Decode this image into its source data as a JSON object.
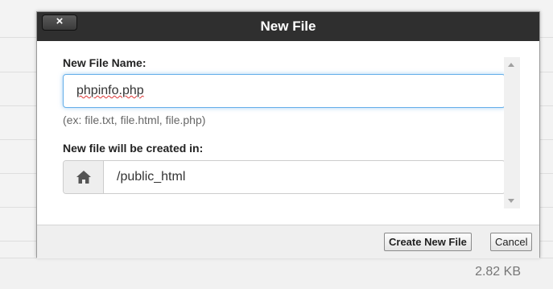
{
  "background": {
    "file_size": "2.82 KB"
  },
  "dialog": {
    "title": "New File",
    "close_label": "×",
    "name_label": "New File Name:",
    "name_value": "phpinfo.php",
    "hint": "(ex: file.txt, file.html, file.php)",
    "path_label": "New file will be created in:",
    "path_icon": "home-icon",
    "path_value": "/public_html",
    "create_button": "Create New File",
    "cancel_button": "Cancel"
  },
  "colors": {
    "titlebar": "#2f2f2f",
    "input_focus": "#66afe9"
  }
}
